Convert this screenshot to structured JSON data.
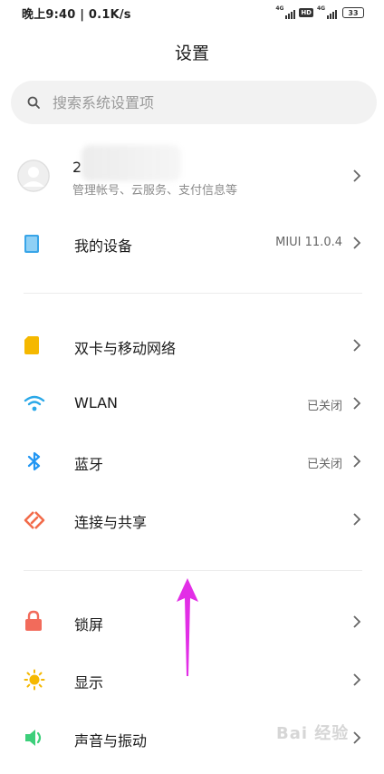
{
  "status_bar": {
    "left_text": "晚上9:40 | 0.1K/s",
    "network_1": "4G",
    "hd_badge": "HD",
    "network_2": "4G",
    "battery": "33"
  },
  "page": {
    "title": "设置"
  },
  "search": {
    "placeholder": "搜索系统设置项"
  },
  "account": {
    "name_visible": "2",
    "subtitle": "管理帐号、云服务、支付信息等"
  },
  "device": {
    "label": "我的设备",
    "value": "MIUI 11.0.4"
  },
  "network_section": [
    {
      "label": "双卡与移动网络",
      "value": "",
      "icon": "sim-card-icon",
      "color": "#f5b800"
    },
    {
      "label": "WLAN",
      "value": "已关闭",
      "icon": "wifi-icon",
      "color": "#2aa8e8"
    },
    {
      "label": "蓝牙",
      "value": "已关闭",
      "icon": "bluetooth-icon",
      "color": "#2196f3"
    },
    {
      "label": "连接与共享",
      "value": "",
      "icon": "share-icon",
      "color": "#f26b4a"
    }
  ],
  "display_section": [
    {
      "label": "锁屏",
      "icon": "lock-icon",
      "color": "#f26b5b"
    },
    {
      "label": "显示",
      "icon": "sun-icon",
      "color": "#f5b800"
    },
    {
      "label": "声音与振动",
      "icon": "speaker-icon",
      "color": "#3ccf7a"
    }
  ],
  "colors": {
    "device_icon": "#39a5e8",
    "arrow": "#e22ee6"
  },
  "watermark": "Bai 经验"
}
